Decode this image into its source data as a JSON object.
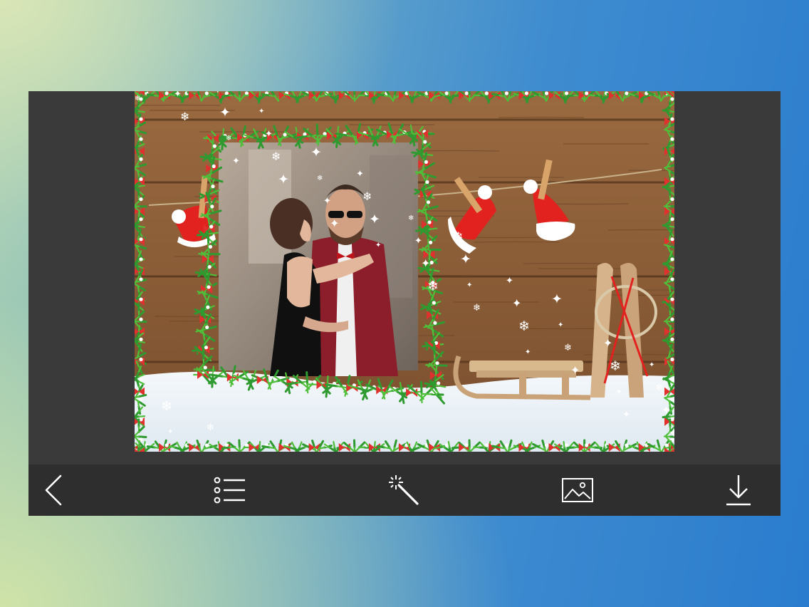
{
  "app": {
    "accent_color": "#ffffff",
    "toolbar_color": "#2e2e2e",
    "panel_color": "#3a3a3a"
  },
  "photo": {
    "theme": "christmas-frame",
    "frame_colors": [
      "#2f9a2f",
      "#e0312f",
      "#ffffff"
    ]
  },
  "toolbar": {
    "buttons": [
      {
        "id": "back",
        "icon": "chevron-left-icon",
        "label": ""
      },
      {
        "id": "frames",
        "icon": "list-icon",
        "label": ""
      },
      {
        "id": "effects",
        "icon": "magic-wand-icon",
        "label": ""
      },
      {
        "id": "gallery",
        "icon": "image-icon",
        "label": ""
      },
      {
        "id": "save",
        "icon": "download-icon",
        "label": ""
      }
    ]
  }
}
